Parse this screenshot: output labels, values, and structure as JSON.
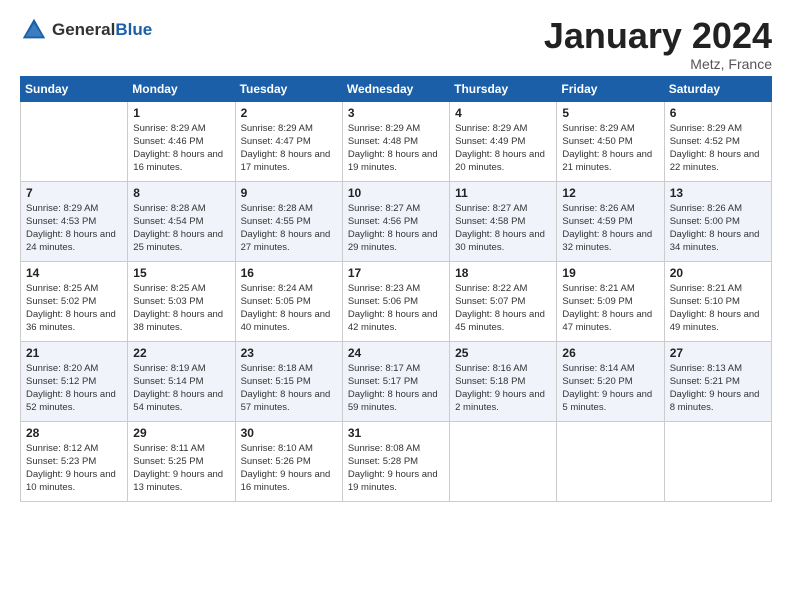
{
  "header": {
    "logo_general": "General",
    "logo_blue": "Blue",
    "month_title": "January 2024",
    "location": "Metz, France"
  },
  "weekdays": [
    "Sunday",
    "Monday",
    "Tuesday",
    "Wednesday",
    "Thursday",
    "Friday",
    "Saturday"
  ],
  "weeks": [
    [
      {
        "day": "",
        "sunrise": "",
        "sunset": "",
        "daylight": ""
      },
      {
        "day": "1",
        "sunrise": "Sunrise: 8:29 AM",
        "sunset": "Sunset: 4:46 PM",
        "daylight": "Daylight: 8 hours and 16 minutes."
      },
      {
        "day": "2",
        "sunrise": "Sunrise: 8:29 AM",
        "sunset": "Sunset: 4:47 PM",
        "daylight": "Daylight: 8 hours and 17 minutes."
      },
      {
        "day": "3",
        "sunrise": "Sunrise: 8:29 AM",
        "sunset": "Sunset: 4:48 PM",
        "daylight": "Daylight: 8 hours and 19 minutes."
      },
      {
        "day": "4",
        "sunrise": "Sunrise: 8:29 AM",
        "sunset": "Sunset: 4:49 PM",
        "daylight": "Daylight: 8 hours and 20 minutes."
      },
      {
        "day": "5",
        "sunrise": "Sunrise: 8:29 AM",
        "sunset": "Sunset: 4:50 PM",
        "daylight": "Daylight: 8 hours and 21 minutes."
      },
      {
        "day": "6",
        "sunrise": "Sunrise: 8:29 AM",
        "sunset": "Sunset: 4:52 PM",
        "daylight": "Daylight: 8 hours and 22 minutes."
      }
    ],
    [
      {
        "day": "7",
        "sunrise": "Sunrise: 8:29 AM",
        "sunset": "Sunset: 4:53 PM",
        "daylight": "Daylight: 8 hours and 24 minutes."
      },
      {
        "day": "8",
        "sunrise": "Sunrise: 8:28 AM",
        "sunset": "Sunset: 4:54 PM",
        "daylight": "Daylight: 8 hours and 25 minutes."
      },
      {
        "day": "9",
        "sunrise": "Sunrise: 8:28 AM",
        "sunset": "Sunset: 4:55 PM",
        "daylight": "Daylight: 8 hours and 27 minutes."
      },
      {
        "day": "10",
        "sunrise": "Sunrise: 8:27 AM",
        "sunset": "Sunset: 4:56 PM",
        "daylight": "Daylight: 8 hours and 29 minutes."
      },
      {
        "day": "11",
        "sunrise": "Sunrise: 8:27 AM",
        "sunset": "Sunset: 4:58 PM",
        "daylight": "Daylight: 8 hours and 30 minutes."
      },
      {
        "day": "12",
        "sunrise": "Sunrise: 8:26 AM",
        "sunset": "Sunset: 4:59 PM",
        "daylight": "Daylight: 8 hours and 32 minutes."
      },
      {
        "day": "13",
        "sunrise": "Sunrise: 8:26 AM",
        "sunset": "Sunset: 5:00 PM",
        "daylight": "Daylight: 8 hours and 34 minutes."
      }
    ],
    [
      {
        "day": "14",
        "sunrise": "Sunrise: 8:25 AM",
        "sunset": "Sunset: 5:02 PM",
        "daylight": "Daylight: 8 hours and 36 minutes."
      },
      {
        "day": "15",
        "sunrise": "Sunrise: 8:25 AM",
        "sunset": "Sunset: 5:03 PM",
        "daylight": "Daylight: 8 hours and 38 minutes."
      },
      {
        "day": "16",
        "sunrise": "Sunrise: 8:24 AM",
        "sunset": "Sunset: 5:05 PM",
        "daylight": "Daylight: 8 hours and 40 minutes."
      },
      {
        "day": "17",
        "sunrise": "Sunrise: 8:23 AM",
        "sunset": "Sunset: 5:06 PM",
        "daylight": "Daylight: 8 hours and 42 minutes."
      },
      {
        "day": "18",
        "sunrise": "Sunrise: 8:22 AM",
        "sunset": "Sunset: 5:07 PM",
        "daylight": "Daylight: 8 hours and 45 minutes."
      },
      {
        "day": "19",
        "sunrise": "Sunrise: 8:21 AM",
        "sunset": "Sunset: 5:09 PM",
        "daylight": "Daylight: 8 hours and 47 minutes."
      },
      {
        "day": "20",
        "sunrise": "Sunrise: 8:21 AM",
        "sunset": "Sunset: 5:10 PM",
        "daylight": "Daylight: 8 hours and 49 minutes."
      }
    ],
    [
      {
        "day": "21",
        "sunrise": "Sunrise: 8:20 AM",
        "sunset": "Sunset: 5:12 PM",
        "daylight": "Daylight: 8 hours and 52 minutes."
      },
      {
        "day": "22",
        "sunrise": "Sunrise: 8:19 AM",
        "sunset": "Sunset: 5:14 PM",
        "daylight": "Daylight: 8 hours and 54 minutes."
      },
      {
        "day": "23",
        "sunrise": "Sunrise: 8:18 AM",
        "sunset": "Sunset: 5:15 PM",
        "daylight": "Daylight: 8 hours and 57 minutes."
      },
      {
        "day": "24",
        "sunrise": "Sunrise: 8:17 AM",
        "sunset": "Sunset: 5:17 PM",
        "daylight": "Daylight: 8 hours and 59 minutes."
      },
      {
        "day": "25",
        "sunrise": "Sunrise: 8:16 AM",
        "sunset": "Sunset: 5:18 PM",
        "daylight": "Daylight: 9 hours and 2 minutes."
      },
      {
        "day": "26",
        "sunrise": "Sunrise: 8:14 AM",
        "sunset": "Sunset: 5:20 PM",
        "daylight": "Daylight: 9 hours and 5 minutes."
      },
      {
        "day": "27",
        "sunrise": "Sunrise: 8:13 AM",
        "sunset": "Sunset: 5:21 PM",
        "daylight": "Daylight: 9 hours and 8 minutes."
      }
    ],
    [
      {
        "day": "28",
        "sunrise": "Sunrise: 8:12 AM",
        "sunset": "Sunset: 5:23 PM",
        "daylight": "Daylight: 9 hours and 10 minutes."
      },
      {
        "day": "29",
        "sunrise": "Sunrise: 8:11 AM",
        "sunset": "Sunset: 5:25 PM",
        "daylight": "Daylight: 9 hours and 13 minutes."
      },
      {
        "day": "30",
        "sunrise": "Sunrise: 8:10 AM",
        "sunset": "Sunset: 5:26 PM",
        "daylight": "Daylight: 9 hours and 16 minutes."
      },
      {
        "day": "31",
        "sunrise": "Sunrise: 8:08 AM",
        "sunset": "Sunset: 5:28 PM",
        "daylight": "Daylight: 9 hours and 19 minutes."
      },
      {
        "day": "",
        "sunrise": "",
        "sunset": "",
        "daylight": ""
      },
      {
        "day": "",
        "sunrise": "",
        "sunset": "",
        "daylight": ""
      },
      {
        "day": "",
        "sunrise": "",
        "sunset": "",
        "daylight": ""
      }
    ]
  ]
}
